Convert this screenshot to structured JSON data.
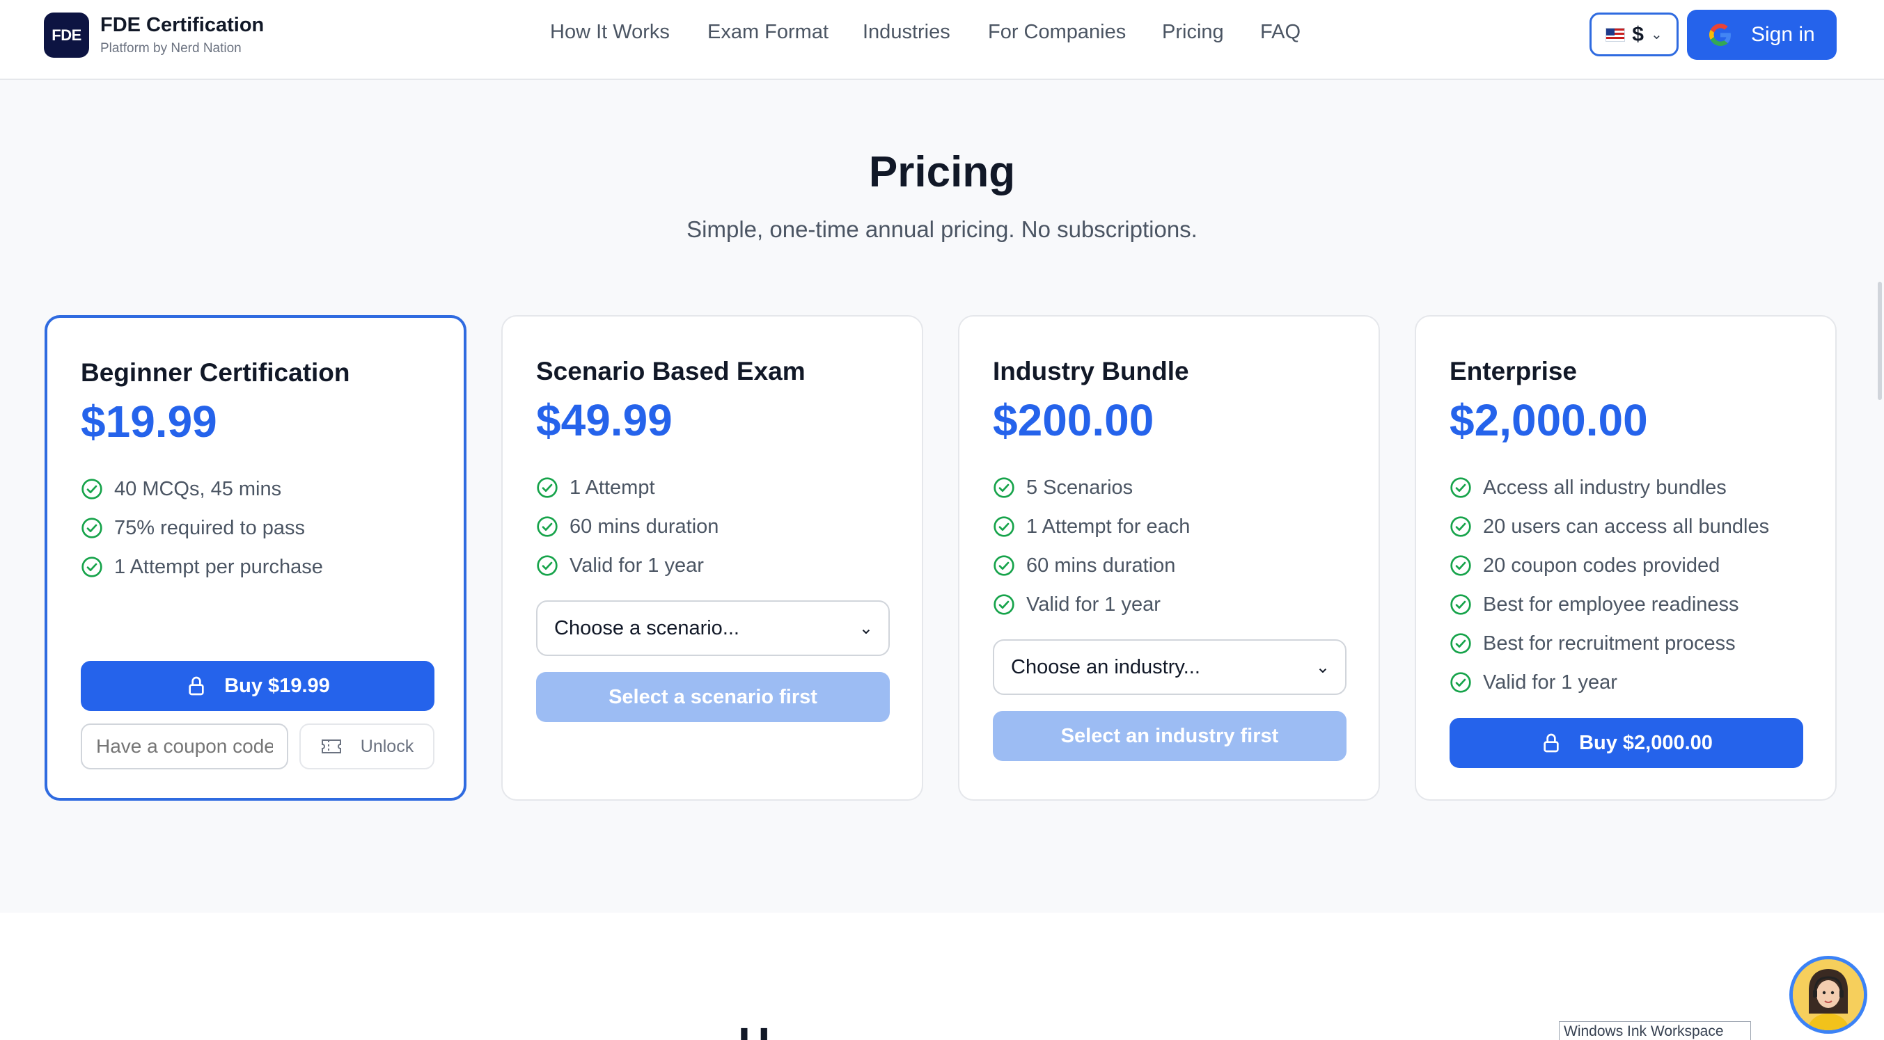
{
  "header": {
    "logo_text": "FDE",
    "brand_title": "FDE Certification",
    "brand_subtitle": "Platform by Nerd Nation",
    "nav": [
      {
        "label": "How It Works"
      },
      {
        "label": "Exam Format"
      },
      {
        "label": "Industries"
      },
      {
        "label": "For Companies"
      },
      {
        "label": "Pricing"
      },
      {
        "label": "FAQ"
      }
    ],
    "currency_symbol": "$",
    "currency_flag": "us-flag-icon",
    "signin_label": "Sign in"
  },
  "pricing": {
    "title": "Pricing",
    "subtitle": "Simple, one-time annual pricing. No subscriptions.",
    "plans": [
      {
        "name": "Beginner Certification",
        "price": "$19.99",
        "features": [
          "40 MCQs, 45 mins",
          "75% required to pass",
          "1 Attempt per purchase"
        ],
        "button_label": "Buy $19.99",
        "coupon_placeholder": "Have a coupon code?",
        "unlock_label": "Unlock"
      },
      {
        "name": "Scenario Based Exam",
        "price": "$49.99",
        "features": [
          "1 Attempt",
          "60 mins duration",
          "Valid for 1 year"
        ],
        "select_value": "Choose a scenario...",
        "button_label": "Select a scenario first"
      },
      {
        "name": "Industry Bundle",
        "price": "$200.00",
        "features": [
          "5 Scenarios",
          "1 Attempt for each",
          "60 mins duration",
          "Valid for 1 year"
        ],
        "select_value": "Choose an industry...",
        "button_label": "Select an industry first"
      },
      {
        "name": "Enterprise",
        "price": "$2,000.00",
        "features": [
          "Access all industry bundles",
          "20 users can access all bundles",
          "20 coupon codes provided",
          "Best for employee readiness",
          "Best for recruitment process",
          "Valid for 1 year"
        ],
        "button_label": "Buy $2,000.00"
      }
    ]
  },
  "next_section_heading": "H",
  "system": {
    "ink_tooltip": "Windows Ink Workspace"
  },
  "colors": {
    "accent": "#2563eb",
    "accent_disabled": "#9cbcf3",
    "check": "#16a34a",
    "logo_bg": "#0d1442"
  }
}
